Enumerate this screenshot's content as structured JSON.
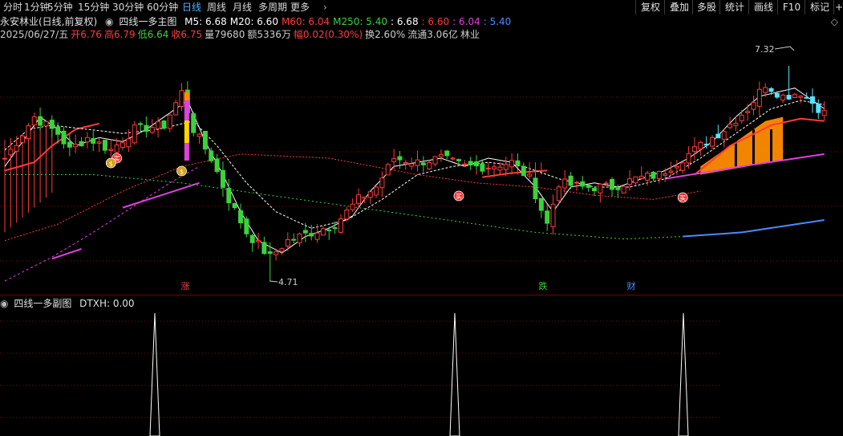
{
  "toolbar": {
    "timeframes": [
      "分时",
      "1分钟",
      "5分钟",
      "15分钟",
      "30分钟",
      "60分钟",
      "日线",
      "周线",
      "月线",
      "多周期",
      "更多"
    ],
    "active": "日线",
    "right_buttons": [
      "复权",
      "叠加",
      "多股",
      "统计",
      "画线",
      "F10",
      "标记"
    ],
    "overflow_glyph": "+",
    "more_arrow": "›"
  },
  "main": {
    "stock_title": "永安林业(日线,前复权)",
    "indicator_icon": "circle-dot-icon",
    "indicator_name": "四线一多主图",
    "ma": [
      {
        "label": "M5: 6.68",
        "color": "#ffffff"
      },
      {
        "label": "M20: 6.60",
        "color": "#ffffff"
      },
      {
        "label": "M60: 6.04",
        "color": "#ff3b3b"
      },
      {
        "label": "M250: 5.40",
        "color": "#3cd23c"
      },
      {
        "label": ": 6.68",
        "color": "#ffffff"
      },
      {
        "label": ": 6.60",
        "color": "#ff3b3b"
      },
      {
        "label": ": 6.04",
        "color": "#e040e0"
      },
      {
        "label": ": 5.40",
        "color": "#4a8bff"
      }
    ],
    "info": [
      {
        "label": "2025/06/27/五",
        "color": "#cccccc"
      },
      {
        "label": "开6.76",
        "color": "#ff3b3b"
      },
      {
        "label": "高6.79",
        "color": "#ff3b3b"
      },
      {
        "label": "低6.64",
        "color": "#3cd23c"
      },
      {
        "label": "收6.75",
        "color": "#ff3b3b"
      },
      {
        "label": "量79680",
        "color": "#cccccc"
      },
      {
        "label": "额5336万",
        "color": "#cccccc"
      },
      {
        "label": "幅0.02(0.30%)",
        "color": "#ff3b3b"
      },
      {
        "label": "换2.60%",
        "color": "#cccccc"
      },
      {
        "label": "流通3.06亿",
        "color": "#cccccc"
      },
      {
        "label": "林业",
        "color": "#cccccc"
      }
    ],
    "settings_icon": "diamond-icon",
    "high_label": "7.32",
    "low_label": "4.71",
    "event_labels": [
      {
        "text": "涨",
        "color": "#ff3b3b"
      },
      {
        "text": "跌",
        "color": "#3cd23c"
      },
      {
        "text": "财",
        "color": "#4a8bff"
      }
    ],
    "badges": [
      "买",
      "买",
      "买",
      "$",
      "$"
    ]
  },
  "sub": {
    "indicator_name": "四线一多副图",
    "value_label": "DTXH: 0.00",
    "colors": {
      "up": "#ff3b3b",
      "down": "#3cd23c",
      "grid": "#8b0000",
      "ma5": "#ffffff",
      "ma20": "#ffffff",
      "ma60": "#ff3b3b",
      "ma250": "#3cd23c",
      "magenta": "#e040e0",
      "blue": "#4a8bff",
      "cyan": "#54e3ff",
      "orange": "#ff8c00"
    }
  }
}
